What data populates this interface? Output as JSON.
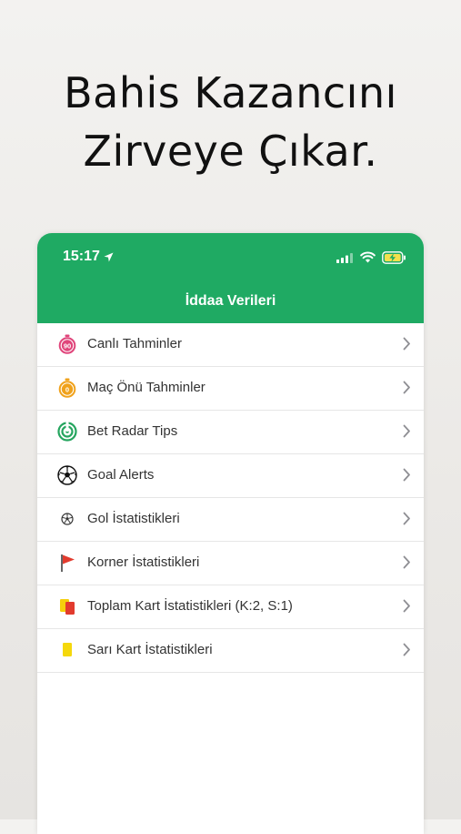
{
  "headline": {
    "line1": "Bahis Kazancını",
    "line2": "Zirveye Çıkar."
  },
  "status_bar": {
    "time": "15:17"
  },
  "nav": {
    "title": "İddaa Verileri"
  },
  "colors": {
    "header_green": "#1faa63",
    "text": "#333333",
    "chevron": "#8e8e93"
  },
  "menu": [
    {
      "label": "Canlı Tahminler",
      "icon": "stopwatch-90-icon"
    },
    {
      "label": "Maç Önü Tahminler",
      "icon": "stopwatch-0-icon"
    },
    {
      "label": "Bet Radar Tips",
      "icon": "radar-icon"
    },
    {
      "label": "Goal Alerts",
      "icon": "soccer-ball-icon"
    },
    {
      "label": "Gol İstatistikleri",
      "icon": "small-soccer-ball-icon"
    },
    {
      "label": "Korner İstatistikleri",
      "icon": "corner-flag-icon"
    },
    {
      "label": "Toplam Kart İstatistikleri (K:2, S:1)",
      "icon": "red-yellow-cards-icon"
    },
    {
      "label": "Sarı Kart İstatistikleri",
      "icon": "yellow-card-icon"
    }
  ]
}
